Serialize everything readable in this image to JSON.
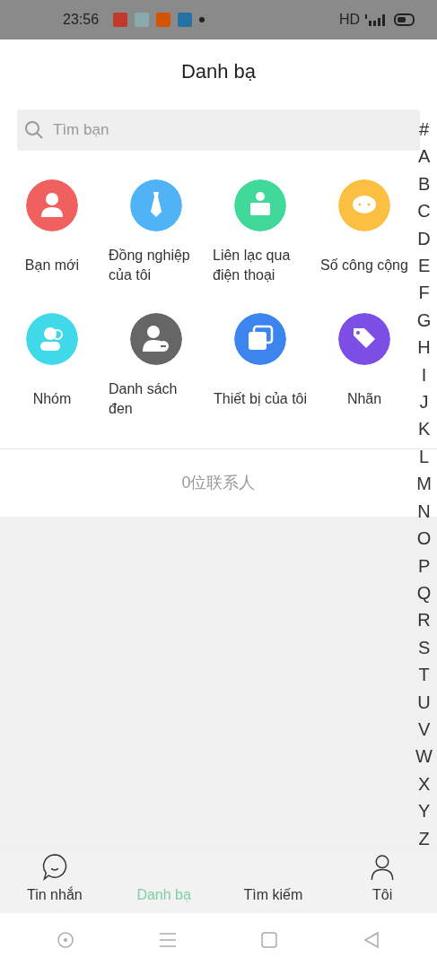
{
  "status_bar": {
    "time": "23:56",
    "network": "HD"
  },
  "header": {
    "title": "Danh bạ"
  },
  "search": {
    "placeholder": "Tìm bạn"
  },
  "shortcuts": [
    {
      "label": "Bạn mới",
      "kind": "person",
      "color": "#f0605e"
    },
    {
      "label": "Đồng nghiệp của tôi",
      "kind": "tie",
      "color": "#4fb3f6"
    },
    {
      "label": "Liên lạc qua điện thoại",
      "kind": "card",
      "color": "#40d99a"
    },
    {
      "label": "Số công cộng",
      "kind": "chat",
      "color": "#fbbf42"
    },
    {
      "label": "Nhóm",
      "kind": "group",
      "color": "#3fd9ea"
    },
    {
      "label": "Danh sách đen",
      "kind": "block",
      "color": "#666666"
    },
    {
      "label": "Thiết bị của tôi",
      "kind": "device",
      "color": "#3d85ee"
    },
    {
      "label": "Nhãn",
      "kind": "tag",
      "color": "#7d4ee6"
    }
  ],
  "contact_count": "0位联系人",
  "index_letters": [
    "#",
    "A",
    "B",
    "C",
    "D",
    "E",
    "F",
    "G",
    "H",
    "I",
    "J",
    "K",
    "L",
    "M",
    "N",
    "O",
    "P",
    "Q",
    "R",
    "S",
    "T",
    "U",
    "V",
    "W",
    "X",
    "Y",
    "Z"
  ],
  "tabs": [
    {
      "label": "Tin nhắn",
      "selected": false
    },
    {
      "label": "Danh bạ",
      "selected": true
    },
    {
      "label": "Tìm kiếm",
      "selected": false
    },
    {
      "label": "Tôi",
      "selected": false
    }
  ]
}
